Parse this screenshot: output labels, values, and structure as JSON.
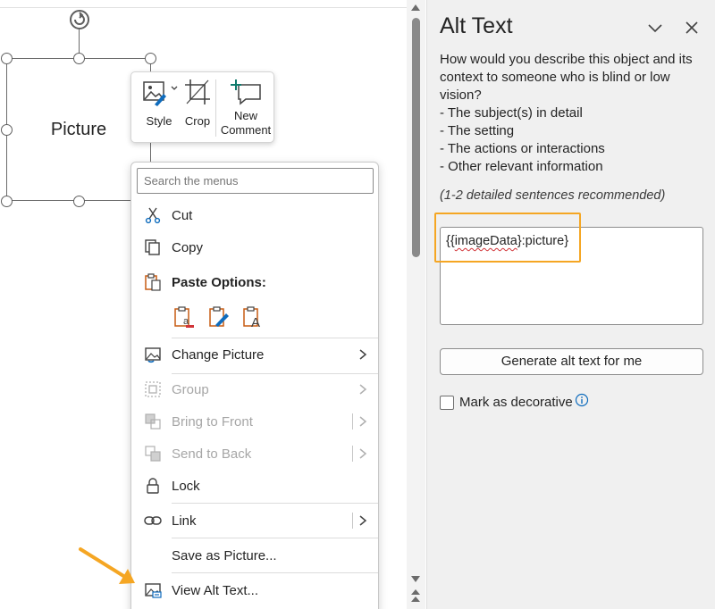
{
  "canvas": {
    "picture_label": "Picture"
  },
  "mini_toolbar": {
    "style_label": "Style",
    "crop_label": "Crop",
    "new_comment_line1": "New",
    "new_comment_line2": "Comment"
  },
  "context_menu": {
    "search_placeholder": "Search the menus",
    "items": [
      {
        "label": "Cut",
        "icon": "scissors-icon",
        "enabled": true
      },
      {
        "label": "Copy",
        "icon": "copy-icon",
        "enabled": true
      },
      {
        "label": "Paste Options:",
        "icon": "clipboard-icon",
        "enabled": true
      },
      {
        "label": "Change Picture",
        "icon": "change-picture-icon",
        "enabled": true,
        "submenu": true
      },
      {
        "label": "Group",
        "icon": "group-icon",
        "enabled": false,
        "submenu": true
      },
      {
        "label": "Bring to Front",
        "icon": "bring-to-front-icon",
        "enabled": false,
        "submenu": true
      },
      {
        "label": "Send to Back",
        "icon": "send-to-back-icon",
        "enabled": false,
        "submenu": true
      },
      {
        "label": "Lock",
        "icon": "lock-icon",
        "enabled": true
      },
      {
        "label": "Link",
        "icon": "link-icon",
        "enabled": true,
        "submenu": true
      },
      {
        "label": "Save as Picture...",
        "icon": "",
        "enabled": true
      },
      {
        "label": "View Alt Text...",
        "icon": "alt-text-icon",
        "enabled": true
      }
    ],
    "paste_options": [
      "paste-keep-source-icon",
      "paste-picture-icon",
      "paste-text-only-icon"
    ]
  },
  "alt_text_pane": {
    "title": "Alt Text",
    "instructions": [
      "How would you describe this object and its",
      "context to someone who is blind or low",
      "vision?",
      "- The subject(s) in detail",
      "- The setting",
      "- The actions or interactions",
      "- Other relevant information"
    ],
    "hint": "(1-2 detailed sentences recommended)",
    "alt_text_prefix": "{{",
    "alt_text_spell": "imageData",
    "alt_text_suffix": "}:picture}",
    "generate_button": "Generate alt text for me",
    "decorative_label": "Mark as decorative",
    "decorative_checked": false
  },
  "colors": {
    "highlight": "#f5a623",
    "accent_teal": "#0f7b6c",
    "accent_blue": "#0f6cbd",
    "paste_orange": "#c75b12"
  }
}
